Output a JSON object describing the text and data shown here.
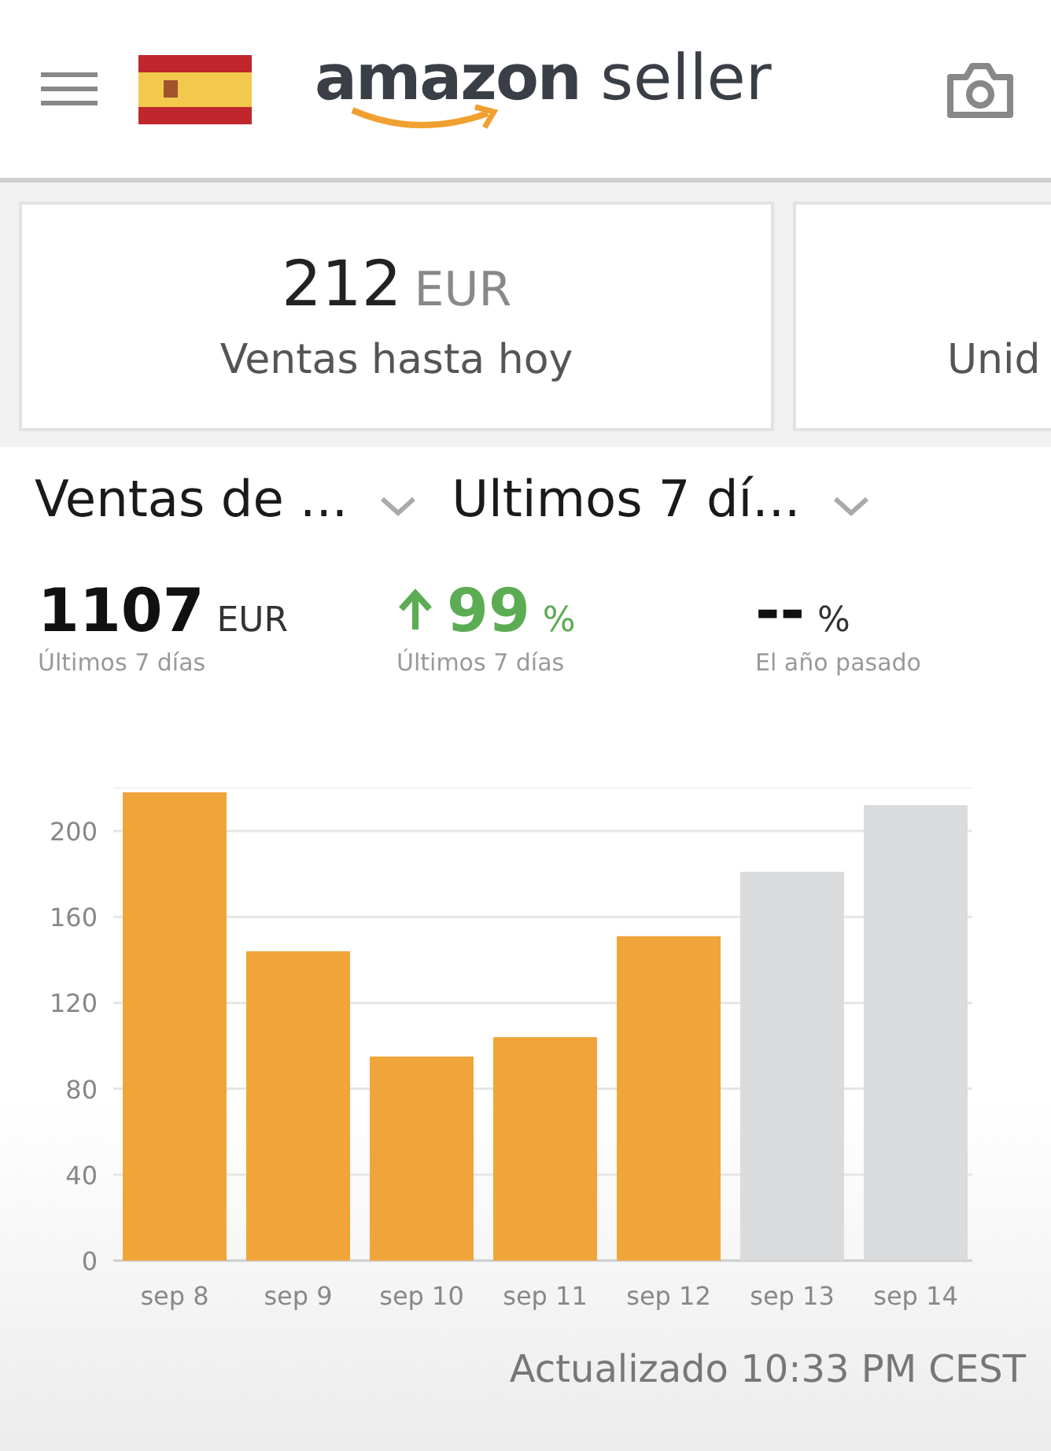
{
  "header": {
    "brand": "amazon",
    "product": "seller"
  },
  "cards": [
    {
      "value": "212",
      "unit": "EUR",
      "label": "Ventas hasta hoy"
    },
    {
      "label": "Unid"
    }
  ],
  "dropdowns": [
    {
      "label": "Ventas de ..."
    },
    {
      "label": "Ultimos 7 dí..."
    }
  ],
  "metrics": [
    {
      "kind": "amount",
      "value": "1107",
      "unit": "EUR",
      "caption": "Últimos 7 días"
    },
    {
      "kind": "change_up",
      "value": "99",
      "unit": "%",
      "caption": "Últimos 7 días"
    },
    {
      "kind": "plain",
      "value": "--",
      "unit": "%",
      "caption": "El año pasado"
    }
  ],
  "chart": {
    "chart_data": {
      "type": "bar",
      "categories": [
        "sep 8",
        "sep 9",
        "sep 10",
        "sep 11",
        "sep 12",
        "sep 13",
        "sep 14"
      ],
      "stacked": true,
      "series": [
        {
          "color": "#f0a53a",
          "values": [
            218,
            144,
            95,
            104,
            151,
            null,
            null
          ]
        },
        {
          "color": "#dadbdd",
          "values": [
            null,
            null,
            null,
            null,
            null,
            181,
            212
          ]
        }
      ],
      "ylim": [
        0,
        220
      ],
      "yticks": [
        0,
        40,
        80,
        120,
        160,
        200
      ],
      "grid": true
    }
  },
  "footer": {
    "updated": "Actualizado 10:33 PM CEST"
  }
}
